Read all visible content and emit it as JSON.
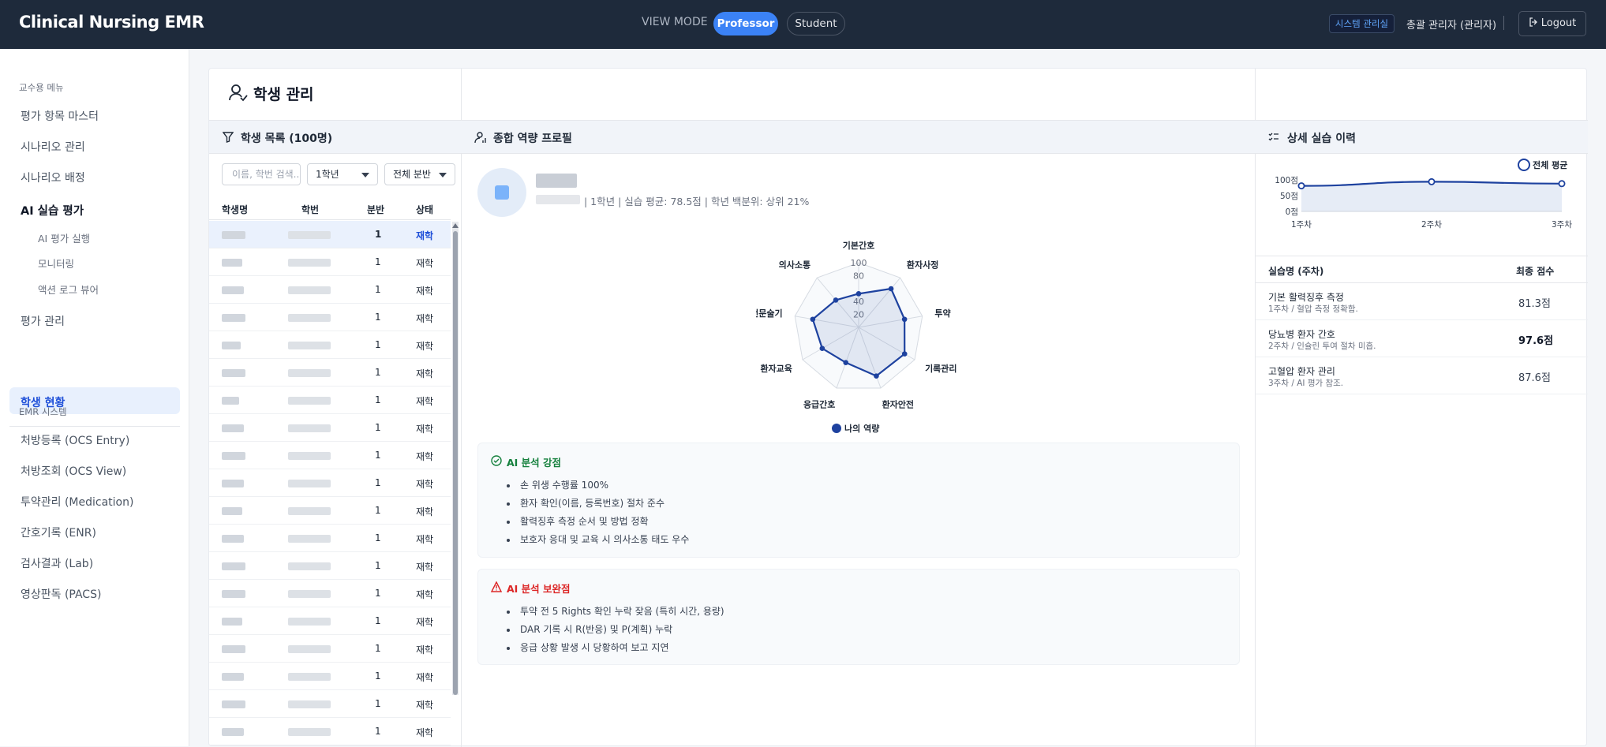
{
  "header": {
    "brand": "Clinical Nursing EMR",
    "view_mode_label": "VIEW MODE",
    "modes": [
      "Professor",
      "Student"
    ],
    "active_mode": "Professor",
    "system_badge": "시스템 관리실",
    "user_label": "총괄 관리자 (관리자)",
    "logout_label": "Logout"
  },
  "sidebar": {
    "professor_section": "교수용 메뉴",
    "items": [
      {
        "label": "평가 항목 마스터"
      },
      {
        "label": "시나리오 관리"
      },
      {
        "label": "시나리오 배정"
      },
      {
        "label": "AI 실습 평가"
      },
      {
        "label": "AI 평가 실행"
      },
      {
        "label": "모니터링"
      },
      {
        "label": "액션 로그 뷰어"
      },
      {
        "label": "평가 관리"
      },
      {
        "label": "학생 현황"
      }
    ],
    "emr_section": "EMR 시스템",
    "emr_items": [
      {
        "label": "처방등록 (OCS Entry)"
      },
      {
        "label": "처방조회 (OCS View)"
      },
      {
        "label": "투약관리 (Medication)"
      },
      {
        "label": "간호기록 (ENR)"
      },
      {
        "label": "검사결과 (Lab)"
      },
      {
        "label": "영상판독 (PACS)"
      }
    ]
  },
  "page": {
    "title": "학생 관리"
  },
  "student_list": {
    "title": "학생 목록 (100명)",
    "search_placeholder": "이름, 학번 검색..",
    "year_filter": "1학년",
    "class_filter": "전체 분반",
    "columns": [
      "학생명",
      "학번",
      "분반",
      "상태"
    ],
    "rows": [
      {
        "class": "1",
        "status": "재학"
      },
      {
        "class": "1",
        "status": "재학"
      },
      {
        "class": "1",
        "status": "재학"
      },
      {
        "class": "1",
        "status": "재학"
      },
      {
        "class": "1",
        "status": "재학"
      },
      {
        "class": "1",
        "status": "재학"
      },
      {
        "class": "1",
        "status": "재학"
      },
      {
        "class": "1",
        "status": "재학"
      },
      {
        "class": "1",
        "status": "재학"
      },
      {
        "class": "1",
        "status": "재학"
      },
      {
        "class": "1",
        "status": "재학"
      },
      {
        "class": "1",
        "status": "재학"
      },
      {
        "class": "1",
        "status": "재학"
      },
      {
        "class": "1",
        "status": "재학"
      },
      {
        "class": "1",
        "status": "재학"
      },
      {
        "class": "1",
        "status": "재학"
      },
      {
        "class": "1",
        "status": "재학"
      },
      {
        "class": "1",
        "status": "재학"
      },
      {
        "class": "1",
        "status": "재학"
      }
    ]
  },
  "profile": {
    "title": "종합 역량 프로필",
    "summary": "| 1학년 | 실습 평균: 78.5점 | 학년 백분위: 상위 21%",
    "strengths_title": "AI 분석 강점",
    "strengths": [
      "손 위생 수행률 100%",
      "환자 확인(이름, 등록번호) 절차 준수",
      "활력징후 측정 순서 및 방법 정확",
      "보호자 응대 및 교육 시 의사소통 태도 우수"
    ],
    "weaknesses_title": "AI 분석 보완점",
    "weaknesses": [
      "투약 전 5 Rights 확인 누락 잦음 (특히 시간, 용량)",
      "DAR 기록 시 R(반응) 및 P(계획) 누락",
      "응급 상황 발생 시 당황하여 보고 지연"
    ]
  },
  "history": {
    "title": "상세 실습 이력",
    "columns": [
      "실습명 (주차)",
      "최종 점수"
    ],
    "rows": [
      {
        "name": "기본 활력징후 측정",
        "sub": "1주차 / 혈압 측정 정확함.",
        "score": "81.3점"
      },
      {
        "name": "당뇨병 환자 간호",
        "sub": "2주차 / 인슐린 투여 절차 미흡.",
        "score": "97.6점"
      },
      {
        "name": "고혈압 환자 관리",
        "sub": "3주차 / AI 평가 참조.",
        "score": "87.6점"
      }
    ]
  },
  "chart_data": [
    {
      "type": "radar",
      "categories": [
        "기본간호",
        "환자사정",
        "투약",
        "기록관리",
        "환자안전",
        "응급간호",
        "환자교육",
        "전문술기",
        "의사소통"
      ],
      "series": [
        {
          "name": "나의 역량",
          "values": [
            52,
            78,
            72,
            82,
            80,
            58,
            65,
            72,
            55
          ]
        }
      ],
      "r_ticks": [
        "20",
        "40",
        "80",
        "100"
      ],
      "rlim": [
        0,
        100
      ],
      "legend": "bottom",
      "color": "#1e429f"
    },
    {
      "type": "line",
      "categories": [
        "1주차",
        "2주차",
        "3주차"
      ],
      "series": [
        {
          "name": "전체 평균",
          "values": [
            81,
            94,
            88
          ]
        }
      ],
      "y_ticks": [
        "100점",
        "50점",
        "0점"
      ],
      "ylim": [
        0,
        100
      ],
      "legend": "top-right",
      "color": "#1e429f"
    }
  ]
}
